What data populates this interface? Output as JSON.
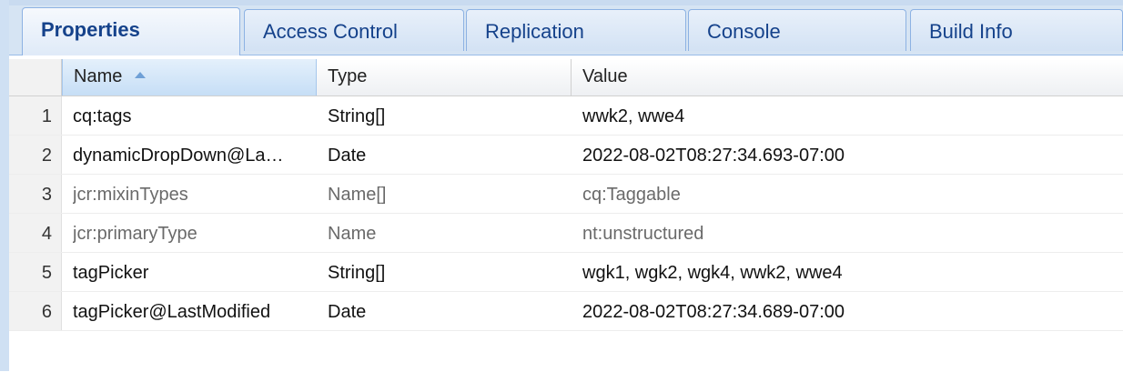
{
  "tabs": [
    {
      "label": "Properties",
      "active": true
    },
    {
      "label": "Access Control",
      "active": false
    },
    {
      "label": "Replication",
      "active": false
    },
    {
      "label": "Console",
      "active": false
    },
    {
      "label": "Build Info",
      "active": false
    }
  ],
  "grid": {
    "columns": [
      {
        "label": "Name",
        "sorted": "ascending"
      },
      {
        "label": "Type"
      },
      {
        "label": "Value"
      }
    ],
    "rows": [
      {
        "num": "1",
        "name": "cq:tags",
        "type": "String[]",
        "value": "wwk2, wwe4",
        "muted": false
      },
      {
        "num": "2",
        "name": "dynamicDropDown@La…",
        "type": "Date",
        "value": "2022-08-02T08:27:34.693-07:00",
        "muted": false
      },
      {
        "num": "3",
        "name": "jcr:mixinTypes",
        "type": "Name[]",
        "value": "cq:Taggable",
        "muted": true
      },
      {
        "num": "4",
        "name": "jcr:primaryType",
        "type": "Name",
        "value": "nt:unstructured",
        "muted": true
      },
      {
        "num": "5",
        "name": "tagPicker",
        "type": "String[]",
        "value": "wgk1, wgk2, wgk4, wwk2, wwe4",
        "muted": false
      },
      {
        "num": "6",
        "name": "tagPicker@LastModified",
        "type": "Date",
        "value": "2022-08-02T08:27:34.689-07:00",
        "muted": false
      }
    ]
  },
  "colors": {
    "tab_text": "#15428b",
    "tabstrip_bg": "#d6e4f3",
    "border": "#99bbe8",
    "muted_text": "#6a6a6a"
  },
  "icons": {
    "sort": "sort-ascending-icon"
  }
}
